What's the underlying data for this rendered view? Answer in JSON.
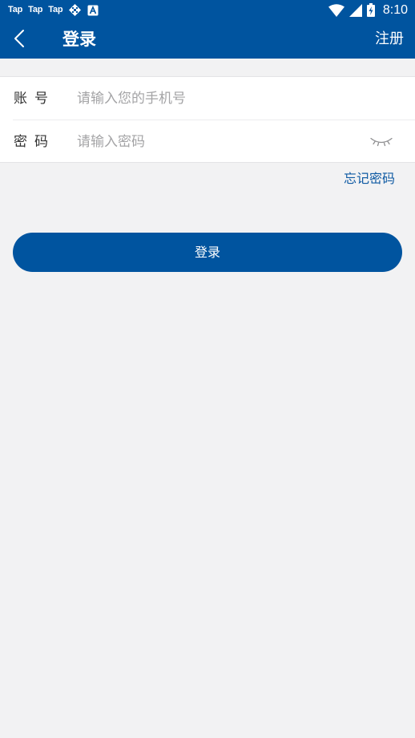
{
  "status_bar": {
    "apps": [
      "Tap",
      "Tap",
      "Tap"
    ],
    "time": "8:10",
    "icons": [
      "sync-icon",
      "a-badge-icon",
      "wifi-icon",
      "cell-signal-icon",
      "battery-charging-icon"
    ]
  },
  "app_bar": {
    "back_icon": "chevron-left-icon",
    "title": "登录",
    "register_label": "注册"
  },
  "form": {
    "account": {
      "label": "账号",
      "placeholder": "请输入您的手机号",
      "value": ""
    },
    "password": {
      "label": "密码",
      "placeholder": "请输入密码",
      "value": "",
      "toggle_icon": "eye-closed-icon"
    }
  },
  "forgot_password_label": "忘记密码",
  "login_button_label": "登录",
  "colors": {
    "primary": "#00549f",
    "background": "#f2f2f3",
    "link": "#0f5aa3",
    "placeholder": "#a4a4a6"
  }
}
